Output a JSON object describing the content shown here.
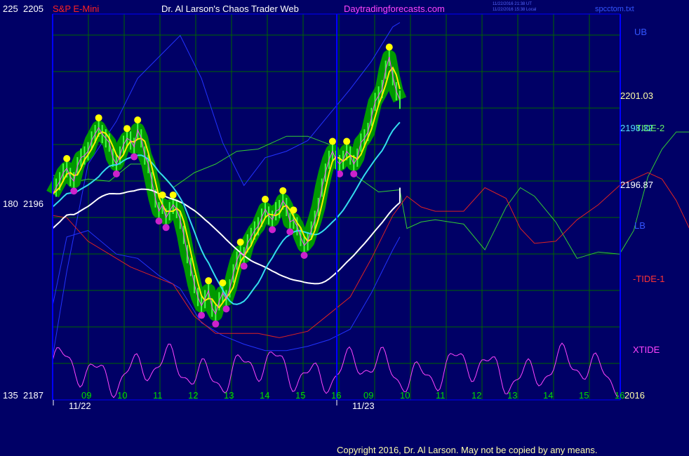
{
  "header": {
    "left_scale": "225",
    "left_price": "2205",
    "symbol": "S&P E-Mini",
    "title": "Dr. Al Larson's Chaos Trader Web",
    "site": "Daytradingforecasts.com",
    "timestamp_utc": "11/22/2016 21:38 UT",
    "timestamp_local": "11/22/2016 15:38 Local",
    "filename": "spcctom.txt"
  },
  "left_axis": {
    "mid_scale": "180",
    "mid_price": "2196",
    "bottom_scale": "135",
    "bottom_price": "2187"
  },
  "right_labels": {
    "ub": "UB",
    "price_high": "2201.03",
    "price_mid1": "2198.32",
    "tide2": "TIDE-2",
    "price_mid2": "2196.87",
    "lb": "LB",
    "tide1": "-TIDE-1",
    "xtide": "XTIDE",
    "year": "2016"
  },
  "colors": {
    "background": "#000066",
    "frame": "#0000ff",
    "grid": "#006600",
    "header_red": "#ff2222",
    "header_white": "#ffffff",
    "site_magenta": "#ff44ff",
    "hour_labels": "#00dd00",
    "date_labels": "#ffffff",
    "copyright": "#ffffaa"
  },
  "chart_data": {
    "type": "line",
    "title": "Dr. Al Larson's Chaos Trader Web",
    "subtitle": "S&P E-Mini",
    "ylabel": "",
    "ylim": [
      2187,
      2205
    ],
    "x_hour_labels": [
      "09",
      "10",
      "11",
      "12",
      "13",
      "14",
      "15",
      "16",
      "09",
      "10",
      "11",
      "12",
      "13",
      "14",
      "15",
      "16"
    ],
    "x_date_labels": [
      "11/22",
      "11/23"
    ],
    "y_tick_labels": [
      "2205",
      "2196",
      "2187"
    ],
    "oscillator_scale_labels": [
      "225",
      "180",
      "135"
    ],
    "price_levels": [
      2201.03,
      2198.32,
      2196.87
    ],
    "price_close_bars": [
      [
        0,
        2196.6
      ],
      [
        1,
        2196.9
      ],
      [
        2,
        2197.2
      ],
      [
        3,
        2197.6
      ],
      [
        4,
        2197.8
      ],
      [
        5,
        2197.4
      ],
      [
        6,
        2197.2
      ],
      [
        7,
        2197.9
      ],
      [
        8,
        2198.3
      ],
      [
        9,
        2198.4
      ],
      [
        10,
        2198.6
      ],
      [
        11,
        2199.1
      ],
      [
        12,
        2199.4
      ],
      [
        13,
        2199.7
      ],
      [
        14,
        2199.4
      ],
      [
        15,
        2199.2
      ],
      [
        16,
        2199.0
      ],
      [
        17,
        2198.3
      ],
      [
        18,
        2198.0
      ],
      [
        19,
        2198.4
      ],
      [
        20,
        2198.9
      ],
      [
        21,
        2199.2
      ],
      [
        22,
        2199.1
      ],
      [
        23,
        2198.8
      ],
      [
        24,
        2199.6
      ],
      [
        25,
        2199.2
      ],
      [
        26,
        2198.4
      ],
      [
        27,
        2198.0
      ],
      [
        28,
        2197.2
      ],
      [
        29,
        2196.4
      ],
      [
        30,
        2195.8
      ],
      [
        31,
        2196.1
      ],
      [
        32,
        2195.5
      ],
      [
        33,
        2195.8
      ],
      [
        34,
        2196.1
      ],
      [
        35,
        2195.9
      ],
      [
        36,
        2195.4
      ],
      [
        37,
        2194.7
      ],
      [
        38,
        2193.8
      ],
      [
        39,
        2193.2
      ],
      [
        40,
        2192.4
      ],
      [
        41,
        2191.8
      ],
      [
        42,
        2191.4
      ],
      [
        43,
        2191.7
      ],
      [
        44,
        2192.1
      ],
      [
        45,
        2191.3
      ],
      [
        46,
        2191.0
      ],
      [
        47,
        2191.6
      ],
      [
        48,
        2192.0
      ],
      [
        49,
        2191.7
      ],
      [
        50,
        2192.2
      ],
      [
        51,
        2192.9
      ],
      [
        52,
        2193.5
      ],
      [
        53,
        2193.9
      ],
      [
        54,
        2193.7
      ],
      [
        55,
        2194.3
      ],
      [
        56,
        2194.6
      ],
      [
        57,
        2194.9
      ],
      [
        58,
        2195.1
      ],
      [
        59,
        2195.5
      ],
      [
        60,
        2195.9
      ],
      [
        61,
        2195.6
      ],
      [
        62,
        2195.4
      ],
      [
        63,
        2195.8
      ],
      [
        64,
        2195.9
      ],
      [
        65,
        2196.3
      ],
      [
        66,
        2196.0
      ],
      [
        67,
        2195.3
      ],
      [
        68,
        2195.4
      ],
      [
        69,
        2195.1
      ],
      [
        70,
        2194.6
      ],
      [
        71,
        2194.2
      ],
      [
        72,
        2194.4
      ],
      [
        73,
        2194.9
      ],
      [
        74,
        2195.4
      ],
      [
        75,
        2196.0
      ],
      [
        76,
        2196.9
      ],
      [
        77,
        2197.6
      ],
      [
        78,
        2198.2
      ],
      [
        79,
        2198.6
      ],
      [
        80,
        2198.2
      ],
      [
        81,
        2198.0
      ],
      [
        82,
        2198.2
      ],
      [
        83,
        2198.6
      ],
      [
        84,
        2198.4
      ],
      [
        85,
        2198.0
      ],
      [
        86,
        2198.3
      ],
      [
        87,
        2199.0
      ],
      [
        88,
        2199.2
      ],
      [
        89,
        2199.5
      ],
      [
        90,
        2200.2
      ],
      [
        91,
        2200.9
      ],
      [
        92,
        2201.2
      ],
      [
        93,
        2201.5
      ],
      [
        94,
        2202.4
      ],
      [
        95,
        2203.0
      ],
      [
        96,
        2202.1
      ],
      [
        97,
        2201.4
      ],
      [
        98,
        2201.0
      ]
    ],
    "series": [
      {
        "name": "UB",
        "values": [
          [
            0,
            2189
          ],
          [
            4,
            2193
          ],
          [
            10,
            2198
          ],
          [
            18,
            2200
          ],
          [
            24,
            2202
          ],
          [
            30,
            2203
          ],
          [
            36,
            2204
          ],
          [
            42,
            2202
          ],
          [
            48,
            2199
          ],
          [
            54,
            2197
          ],
          [
            60,
            2198.3
          ],
          [
            66,
            2198.6
          ],
          [
            72,
            2199.1
          ],
          [
            78,
            2200.3
          ],
          [
            84,
            2201.5
          ],
          [
            90,
            2202.8
          ],
          [
            96,
            2204.4
          ],
          [
            98,
            2204.6
          ]
        ]
      },
      {
        "name": "LB",
        "values": [
          [
            0,
            2191.4
          ],
          [
            4,
            2194.6
          ],
          [
            10,
            2194.9
          ],
          [
            18,
            2193.8
          ],
          [
            24,
            2193.6
          ],
          [
            30,
            2192.8
          ],
          [
            36,
            2192.2
          ],
          [
            42,
            2190.6
          ],
          [
            48,
            2190.0
          ],
          [
            54,
            2189.6
          ],
          [
            60,
            2189.3
          ],
          [
            66,
            2189.3
          ],
          [
            72,
            2189.5
          ],
          [
            78,
            2189.8
          ],
          [
            84,
            2190.3
          ],
          [
            90,
            2192.0
          ],
          [
            96,
            2194.0
          ],
          [
            98,
            2194.6
          ]
        ]
      },
      {
        "name": "TIDE-2",
        "values": [
          [
            0,
            2197.5
          ],
          [
            4,
            2197.1
          ],
          [
            10,
            2197.3
          ],
          [
            16,
            2197.2
          ],
          [
            22,
            2198.0
          ],
          [
            28,
            2198.0
          ],
          [
            34,
            2196.9
          ],
          [
            40,
            2197.6
          ],
          [
            46,
            2198.0
          ],
          [
            52,
            2198.6
          ],
          [
            58,
            2198.7
          ],
          [
            66,
            2199.3
          ],
          [
            72,
            2199.3
          ],
          [
            80,
            2198.8
          ],
          [
            86,
            2197.4
          ],
          [
            92,
            2196.7
          ],
          [
            98,
            2196.8
          ],
          [
            100,
            2195.0
          ],
          [
            104,
            2195.3
          ],
          [
            108,
            2195.4
          ],
          [
            116,
            2195.2
          ],
          [
            122,
            2194.0
          ],
          [
            128,
            2196.0
          ],
          [
            132,
            2196.9
          ],
          [
            136,
            2196.5
          ],
          [
            142,
            2195.3
          ],
          [
            148,
            2193.6
          ],
          [
            154,
            2193.9
          ],
          [
            160,
            2193.8
          ],
          [
            164,
            2194.9
          ],
          [
            168,
            2197.4
          ],
          [
            172,
            2198.7
          ],
          [
            176,
            2199.5
          ],
          [
            180,
            2199.5
          ]
        ]
      },
      {
        "name": "-TIDE-1",
        "values": [
          [
            0,
            2195.6
          ],
          [
            4,
            2195.5
          ],
          [
            10,
            2194.4
          ],
          [
            16,
            2193.8
          ],
          [
            22,
            2193.2
          ],
          [
            28,
            2192.8
          ],
          [
            34,
            2192.4
          ],
          [
            40,
            2190.9
          ],
          [
            46,
            2190.1
          ],
          [
            52,
            2190.1
          ],
          [
            58,
            2190.1
          ],
          [
            64,
            2189.9
          ],
          [
            72,
            2190.2
          ],
          [
            78,
            2191.0
          ],
          [
            84,
            2191.8
          ],
          [
            90,
            2193.6
          ],
          [
            96,
            2195.6
          ],
          [
            100,
            2196.5
          ],
          [
            104,
            2196.0
          ],
          [
            108,
            2195.8
          ],
          [
            116,
            2195.8
          ],
          [
            122,
            2196.9
          ],
          [
            128,
            2196.4
          ],
          [
            132,
            2195.0
          ],
          [
            136,
            2194.3
          ],
          [
            142,
            2194.4
          ],
          [
            148,
            2195.4
          ],
          [
            154,
            2196.1
          ],
          [
            160,
            2197.0
          ],
          [
            164,
            2197.3
          ],
          [
            168,
            2197.6
          ],
          [
            172,
            2197.3
          ],
          [
            176,
            2196.3
          ],
          [
            180,
            2194.9
          ]
        ]
      }
    ],
    "grid": true,
    "legend": "none"
  }
}
